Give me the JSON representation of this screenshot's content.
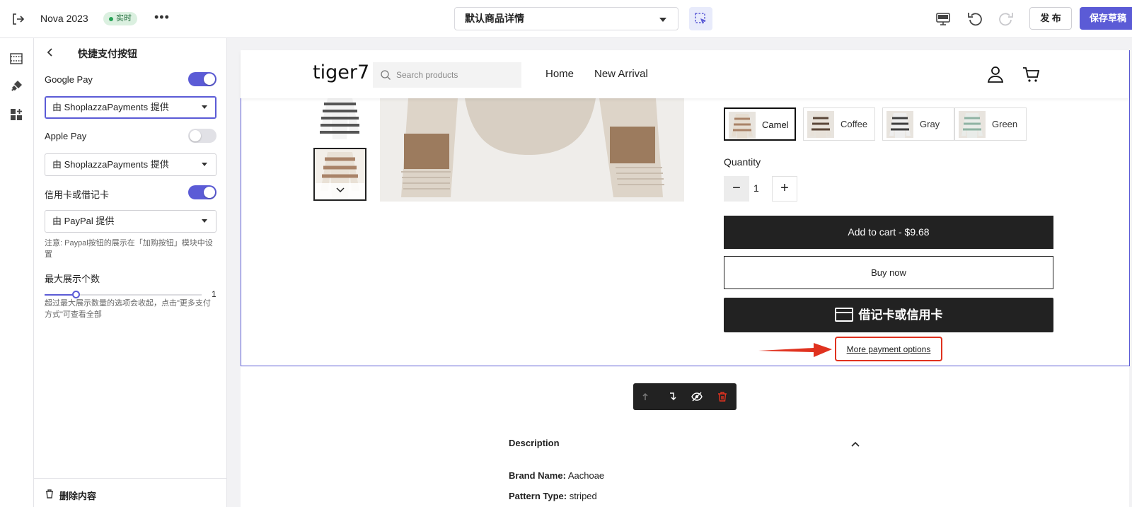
{
  "topbar": {
    "theme_name": "Nova 2023",
    "live_badge": "实时",
    "more_label": "•••",
    "template_select": "默认商品详情",
    "publish_label": "发 布",
    "save_draft_label": "保存草稿"
  },
  "panel": {
    "title": "快捷支付按钮",
    "google_pay": {
      "label": "Google Pay",
      "enabled": true,
      "provider": "由 ShoplazzaPayments 提供"
    },
    "apple_pay": {
      "label": "Apple Pay",
      "enabled": false,
      "provider": "由 ShoplazzaPayments 提供"
    },
    "card": {
      "label": "信用卡或借记卡",
      "enabled": true,
      "provider": "由 PayPal 提供"
    },
    "paypal_note": "注意: Paypal按钮的展示在「加购按钮」模块中设置",
    "max_display": {
      "label": "最大展示个数",
      "value": "1",
      "fill_fraction": 0.2
    },
    "max_display_note": "超过最大展示数量的选项会收起，点击\"更多支付方式\"可查看全部",
    "footer_label": "删除内容"
  },
  "store": {
    "logo": "tiger7",
    "search_placeholder": "Search products",
    "nav": [
      "Home",
      "New Arrival"
    ],
    "variants": [
      "Camel",
      "Coffee",
      "Gray",
      "Green"
    ],
    "quantity_label": "Quantity",
    "quantity_value": "1",
    "add_to_cart": "Add to cart  -  $9.68",
    "buy_now": "Buy now",
    "card_button": "借记卡或信用卡",
    "more_payment_options": "More payment options",
    "description_title": "Description",
    "brand_label": "Brand Name:",
    "brand_value": "Aachoae",
    "pattern_label": "Pattern Type:",
    "pattern_value": "striped"
  },
  "colors": {
    "accent": "#5b5bd6",
    "highlight_red": "#e0321f",
    "live_green": "#27a255",
    "dark_button": "#222222"
  }
}
